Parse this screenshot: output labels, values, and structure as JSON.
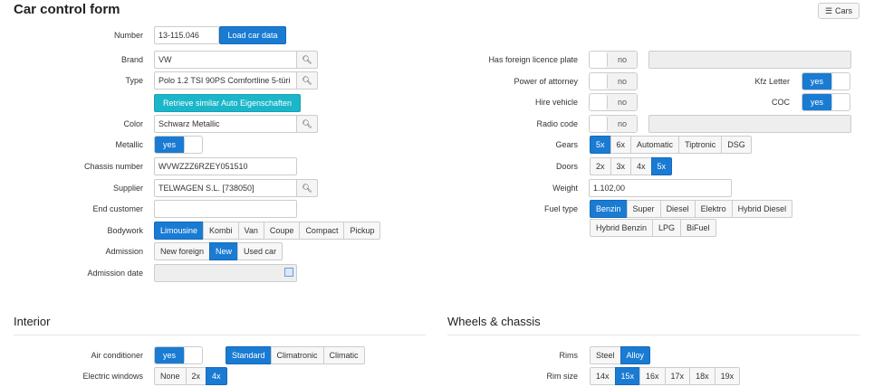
{
  "header": {
    "title": "Car control form",
    "cars_button": "Cars"
  },
  "left": {
    "number": {
      "label": "Number",
      "value": "13-115.046",
      "load_button": "Load car data"
    },
    "brand": {
      "label": "Brand",
      "value": "VW"
    },
    "type": {
      "label": "Type",
      "value": "Polo 1.2 TSI 90PS Comfortline 5-türi",
      "retrieve_button": "Retrieve similar Auto Eigenschaften"
    },
    "color": {
      "label": "Color",
      "value": "Schwarz Metallic"
    },
    "metallic": {
      "label": "Metallic",
      "value": "yes"
    },
    "chassis": {
      "label": "Chassis number",
      "value": "WVWZZZ6RZEY051510"
    },
    "supplier": {
      "label": "Supplier",
      "value": "TELWAGEN  S.L. [738050]"
    },
    "end_customer": {
      "label": "End customer",
      "value": ""
    },
    "bodywork": {
      "label": "Bodywork",
      "options": [
        "Limousine",
        "Kombi",
        "Van",
        "Coupe",
        "Compact",
        "Pickup"
      ],
      "selected": "Limousine"
    },
    "admission": {
      "label": "Admission",
      "options": [
        "New foreign",
        "New",
        "Used car"
      ],
      "selected": "New"
    },
    "admission_date": {
      "label": "Admission date",
      "value": ""
    }
  },
  "right": {
    "foreign_plate": {
      "label": "Has foreign licence plate",
      "value": "no"
    },
    "power_attorney": {
      "label": "Power of attorney",
      "value": "no"
    },
    "kfz_letter": {
      "label": "Kfz Letter",
      "value": "yes"
    },
    "hire_vehicle": {
      "label": "Hire vehicle",
      "value": "no"
    },
    "coc": {
      "label": "COC",
      "value": "yes"
    },
    "radio_code": {
      "label": "Radio code",
      "value": "no"
    },
    "gears": {
      "label": "Gears",
      "options": [
        "5x",
        "6x",
        "Automatic",
        "Tiptronic",
        "DSG"
      ],
      "selected": "5x"
    },
    "doors": {
      "label": "Doors",
      "options": [
        "2x",
        "3x",
        "4x",
        "5x"
      ],
      "selected": "5x"
    },
    "weight": {
      "label": "Weight",
      "value": "1.102,00"
    },
    "fuel": {
      "label": "Fuel type",
      "options_row1": [
        "Benzin",
        "Super",
        "Diesel",
        "Elektro",
        "Hybrid Diesel"
      ],
      "options_row2": [
        "Hybrid Benzin",
        "LPG",
        "BiFuel"
      ],
      "selected": "Benzin"
    }
  },
  "interior": {
    "title": "Interior",
    "air_conditioner": {
      "label": "Air conditioner",
      "value": "yes",
      "options": [
        "Standard",
        "Climatronic",
        "Climatic"
      ],
      "selected": "Standard"
    },
    "electric_windows": {
      "label": "Electric windows",
      "options": [
        "None",
        "2x",
        "4x"
      ],
      "selected": "4x"
    }
  },
  "wheels": {
    "title": "Wheels & chassis",
    "rims": {
      "label": "Rims",
      "options": [
        "Steel",
        "Alloy"
      ],
      "selected": "Alloy"
    },
    "rim_size": {
      "label": "Rim size",
      "options": [
        "14x",
        "15x",
        "16x",
        "17x",
        "18x",
        "19x"
      ],
      "selected": "15x"
    }
  },
  "colors": {
    "primary": "#1a7bd3",
    "teal": "#1bb6c9"
  }
}
